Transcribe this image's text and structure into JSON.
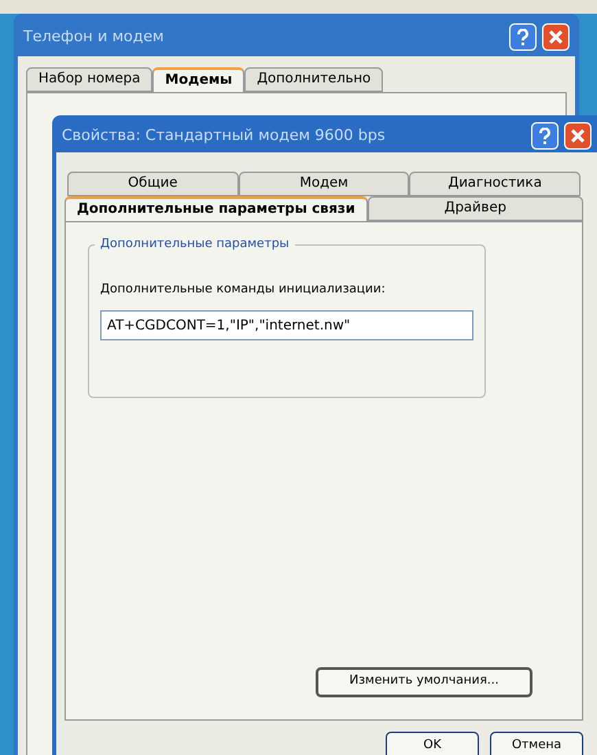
{
  "outer_window": {
    "title": "Телефон и модем",
    "tabs": [
      {
        "label": "Набор номера",
        "selected": false
      },
      {
        "label": "Модемы",
        "selected": true
      },
      {
        "label": "Дополнительно",
        "selected": false
      }
    ]
  },
  "dialog": {
    "title": "Свойства: Стандартный модем 9600 bps",
    "tab_rows": [
      [
        {
          "label": "Общие",
          "selected": false
        },
        {
          "label": "Модем",
          "selected": false
        },
        {
          "label": "Диагностика",
          "selected": false
        }
      ],
      [
        {
          "label": "Дополнительные параметры связи",
          "selected": true
        },
        {
          "label": "Драйвер",
          "selected": false
        }
      ]
    ],
    "group": {
      "title": "Дополнительные параметры",
      "field_label": "Дополнительные команды инициализации:",
      "field_value": "AT+CGDCONT=1,\"IP\",\"internet.nw\""
    },
    "defaults_button": "Изменить умолчания...",
    "buttons": [
      "OK",
      "Отмена"
    ]
  }
}
